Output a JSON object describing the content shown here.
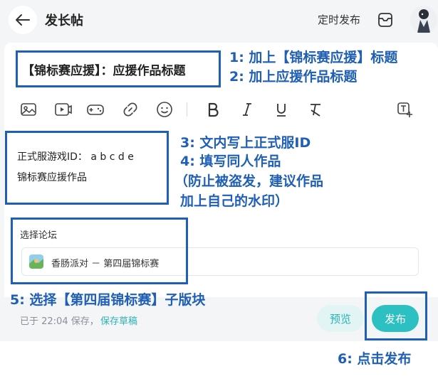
{
  "header": {
    "title": "发长帖",
    "schedule_label": "定时发布"
  },
  "editor": {
    "title_value": "【锦标赛应援】：应援作品标题",
    "body_lines": [
      "正式服游戏ID：  a b c d e",
      "锦标赛应援作品"
    ],
    "toolbar": [
      "image-icon",
      "video-icon",
      "gamepad-icon",
      "link-icon",
      "emoji-icon",
      "bold-icon",
      "italic-icon",
      "underline-icon",
      "clear-format-icon",
      "text-insert-icon"
    ]
  },
  "forum": {
    "label": "选择论坛",
    "selected": "香肠派对 － 第四届锦标赛"
  },
  "footer": {
    "save_status": "已于 22:04 保存，",
    "save_draft": "保存草稿",
    "preview": "预览",
    "publish": "发布"
  },
  "annotations": {
    "a1": "1:  加上【锦标赛应援】标题",
    "a2": "2:  加上应援作品标题",
    "a3": "3:  文内写上正式服ID",
    "a4": "4:  填写同人作品",
    "a4b": "（防止被盗发，建议作品",
    "a4c": "加上自己的水印）",
    "a5": "5:  选择【第四届锦标赛】子版块",
    "a6": "6:  点击发布"
  },
  "colors": {
    "annotation": "#1f5fb5",
    "accent": "#2cc0c3",
    "preview_bg": "#e2f4f4",
    "page_bg": "#f4f5f7"
  }
}
